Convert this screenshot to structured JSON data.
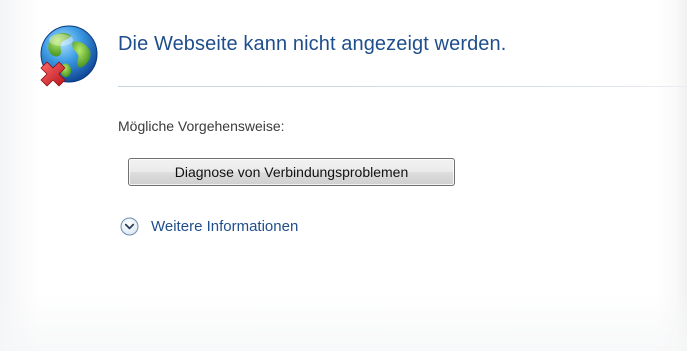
{
  "error_page": {
    "title": "Die Webseite kann nicht angezeigt werden.",
    "section_label": "Mögliche Vorgehensweise:",
    "diagnose_button_label": "Diagnose von Verbindungsproblemen",
    "more_info_label": "Weitere Informationen"
  },
  "icons": {
    "status": "globe-error-icon",
    "expand": "chevron-down-circle-icon"
  },
  "colors": {
    "title_text": "#1f4e8c",
    "link_text": "#1f4e8c",
    "error_mark": "#d9272e"
  }
}
